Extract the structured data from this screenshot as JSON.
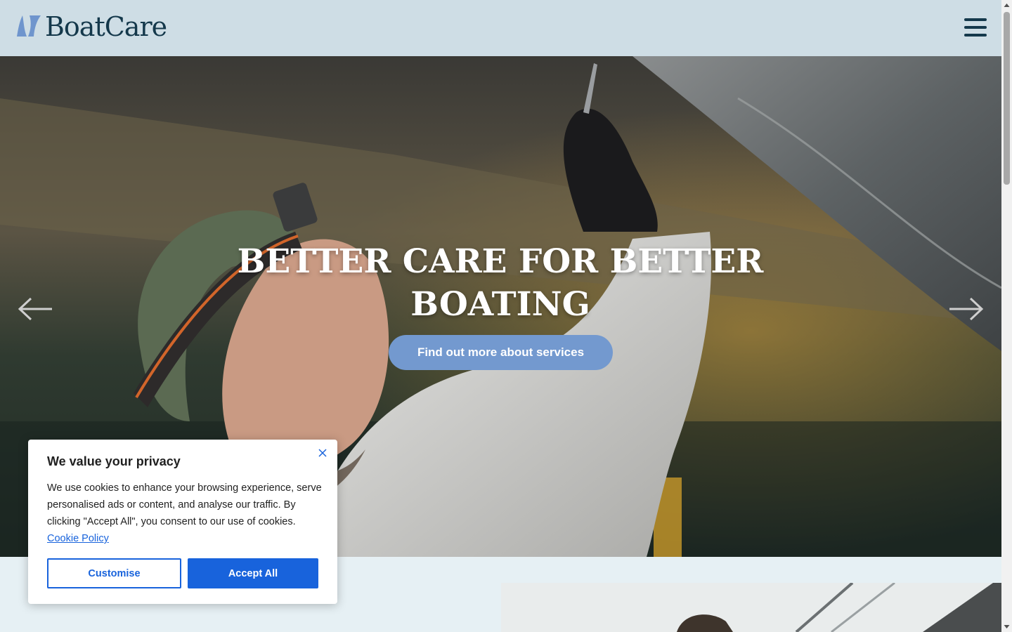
{
  "brand": {
    "name": "BoatCare",
    "logo_icon": "sail-logo-icon",
    "color_primary": "#14384b",
    "color_logo_mark": "#6f95cd"
  },
  "header": {
    "menu_icon": "hamburger-menu-icon"
  },
  "hero": {
    "title": "BETTER CARE FOR BETTER BOATING",
    "cta_label": "Find out more about services",
    "cta_color": "#7399cf",
    "prev_icon": "arrow-left-icon",
    "next_icon": "arrow-right-icon",
    "image_description_icon": "hero-photo"
  },
  "cookie_banner": {
    "title": "We value your privacy",
    "body": "We use cookies to enhance your browsing experience, serve personalised ads or content, and analyse our traffic. By clicking \"Accept All\", you consent to our use of cookies.",
    "policy_link": "Cookie Policy",
    "customise_label": "Customise",
    "accept_label": "Accept All",
    "close_icon": "close-icon",
    "accent_color": "#1863dc"
  }
}
